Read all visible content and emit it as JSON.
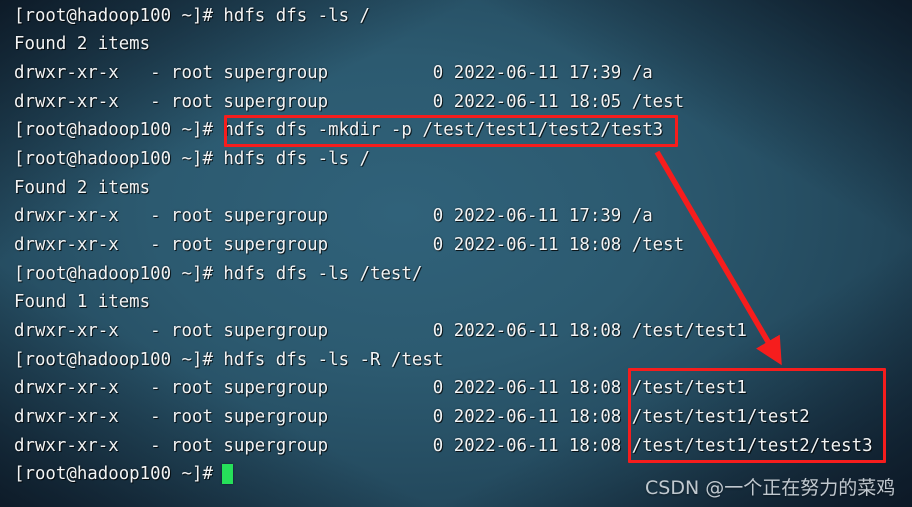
{
  "terminal": {
    "prompt": "[root@hadoop100 ~]#",
    "hostname": "hadoop100",
    "user": "root",
    "cursor_glyph": "block-cursor",
    "colors": {
      "background_center": "#30627a",
      "background_corner": "#14263a",
      "text": "#f2f4f5",
      "cursor": "#26e05a",
      "annotation": "#f61d1d"
    },
    "lines": [
      {
        "text": "[root@hadoop100 ~]# hdfs dfs -ls /",
        "kind": "command"
      },
      {
        "text": "Found 2 items",
        "kind": "output"
      },
      {
        "text": "drwxr-xr-x   - root supergroup          0 2022-06-11 17:39 /a",
        "kind": "output"
      },
      {
        "text": "drwxr-xr-x   - root supergroup          0 2022-06-11 18:05 /test",
        "kind": "output"
      },
      {
        "text": "[root@hadoop100 ~]# hdfs dfs -mkdir -p /test/test1/test2/test3",
        "kind": "command"
      },
      {
        "text": "[root@hadoop100 ~]# hdfs dfs -ls /",
        "kind": "command"
      },
      {
        "text": "Found 2 items",
        "kind": "output"
      },
      {
        "text": "drwxr-xr-x   - root supergroup          0 2022-06-11 17:39 /a",
        "kind": "output"
      },
      {
        "text": "drwxr-xr-x   - root supergroup          0 2022-06-11 18:08 /test",
        "kind": "output"
      },
      {
        "text": "[root@hadoop100 ~]# hdfs dfs -ls /test/",
        "kind": "command"
      },
      {
        "text": "Found 1 items",
        "kind": "output"
      },
      {
        "text": "drwxr-xr-x   - root supergroup          0 2022-06-11 18:08 /test/test1",
        "kind": "output"
      },
      {
        "text": "[root@hadoop100 ~]# hdfs dfs -ls -R /test",
        "kind": "command"
      },
      {
        "text": "drwxr-xr-x   - root supergroup          0 2022-06-11 18:08 /test/test1",
        "kind": "output"
      },
      {
        "text": "drwxr-xr-x   - root supergroup          0 2022-06-11 18:08 /test/test1/test2",
        "kind": "output"
      },
      {
        "text": "drwxr-xr-x   - root supergroup          0 2022-06-11 18:08 /test/test1/test2/test3",
        "kind": "output"
      },
      {
        "text": "[root@hadoop100 ~]# ",
        "kind": "prompt"
      }
    ]
  },
  "annotations": {
    "command_highlight": {
      "label": "hdfs dfs -mkdir -p /test/test1/test2/test3",
      "note": "highlighted-mkdir-command"
    },
    "result_highlight": {
      "lines": [
        "/test/test1",
        "/test/test1/test2",
        "/test/test1/test2/test3"
      ],
      "note": "highlighted-recursive-result"
    },
    "arrow": {
      "note": "arrow-command-to-result"
    }
  },
  "watermark": {
    "text": "CSDN @一个正在努力的菜鸡"
  }
}
